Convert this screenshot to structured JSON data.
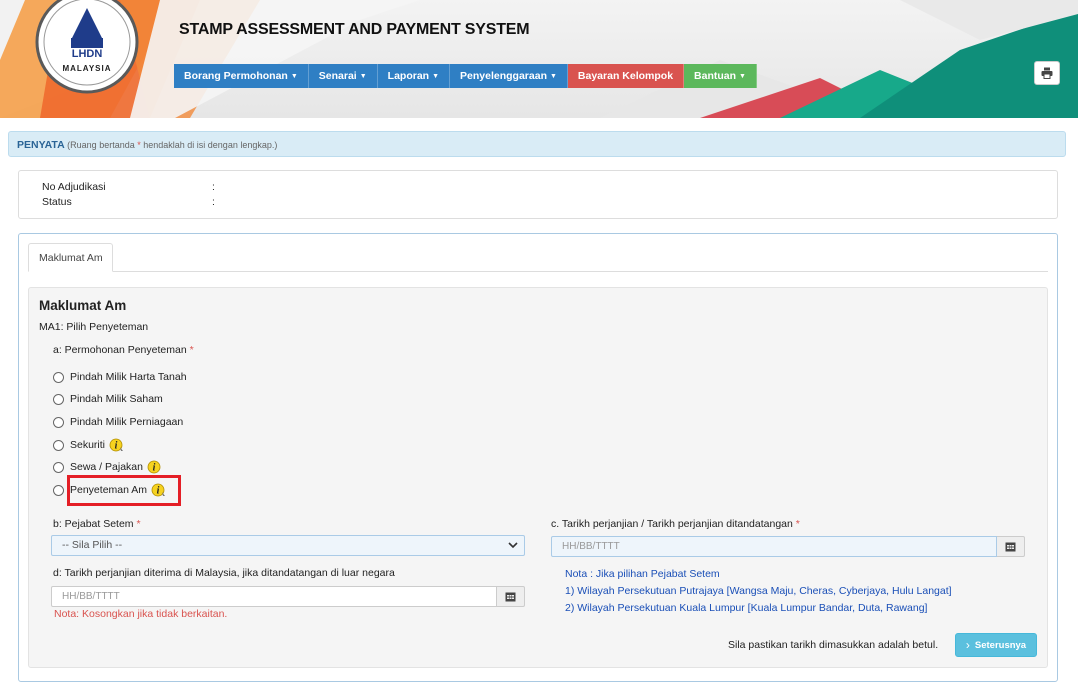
{
  "header": {
    "system_title": "STAMP ASSESSMENT AND PAYMENT SYSTEM",
    "logo_top_text": "LHDN",
    "logo_bottom_text": "MALAYSIA",
    "nav": [
      {
        "label": "Borang Permohonan",
        "dropdown": true
      },
      {
        "label": "Senarai",
        "dropdown": true
      },
      {
        "label": "Laporan",
        "dropdown": true
      },
      {
        "label": "Penyelenggaraan",
        "dropdown": true
      },
      {
        "label": "Bayaran Kelompok",
        "dropdown": false
      },
      {
        "label": "Bantuan",
        "dropdown": true
      }
    ],
    "print_icon": "printer-icon"
  },
  "penyata": {
    "title": "PENYATA",
    "hint_prefix": "(Ruang bertanda ",
    "hint_star": "*",
    "hint_suffix": " hendaklah di isi dengan lengkap.)"
  },
  "info": {
    "no_adjudikasi_label": "No Adjudikasi",
    "status_label": "Status",
    "colon": ":"
  },
  "tabs": [
    {
      "label": "Maklumat Am",
      "active": true
    }
  ],
  "form": {
    "section_title": "Maklumat Am",
    "subtitle": "MA1: Pilih Penyeteman",
    "permohonan_label": "a: Permohonan Penyeteman",
    "options": [
      {
        "label": "Pindah Milik Harta Tanah",
        "info": false
      },
      {
        "label": "Pindah Milik Saham",
        "info": false
      },
      {
        "label": "Pindah Milik Perniagaan",
        "info": false
      },
      {
        "label": "Sekuriti",
        "info": true
      },
      {
        "label": "Sewa / Pajakan",
        "info": true
      },
      {
        "label": "Penyeteman Am",
        "info": true
      }
    ],
    "pejabat_label": "b: Pejabat Setem",
    "pejabat_value": "-- Sila Pilih --",
    "tarikh_label": "c. Tarikh perjanjian / Tarikh perjanjian ditandatangan",
    "tarikh_placeholder": "HH/BB/TTTT",
    "tarikh_diterima_label": "d: Tarikh perjanjian diterima di Malaysia, jika ditandatangan di luar negara",
    "tarikh_diterima_placeholder": "HH/BB/TTTT",
    "note_red": "Nota: Kosongkan jika tidak berkaitan.",
    "note_blue": [
      "Nota : Jika pilihan Pejabat Setem",
      "1) Wilayah Persekutuan Putrajaya [Wangsa Maju, Cheras, Cyberjaya, Hulu Langat]",
      "2) Wilayah Persekutuan Kuala Lumpur [Kuala Lumpur Bandar, Duta, Rawang]"
    ],
    "required_star": "*",
    "confirm_text": "Sila pastikan tarikh dimasukkan adalah betul.",
    "next_label": "Seterusnya"
  },
  "colors": {
    "nav_blue": "#2f7fc4",
    "nav_red": "#d9534f",
    "nav_green": "#5cb85c",
    "next_button": "#5bc0de",
    "highlight": "#e41e26"
  }
}
